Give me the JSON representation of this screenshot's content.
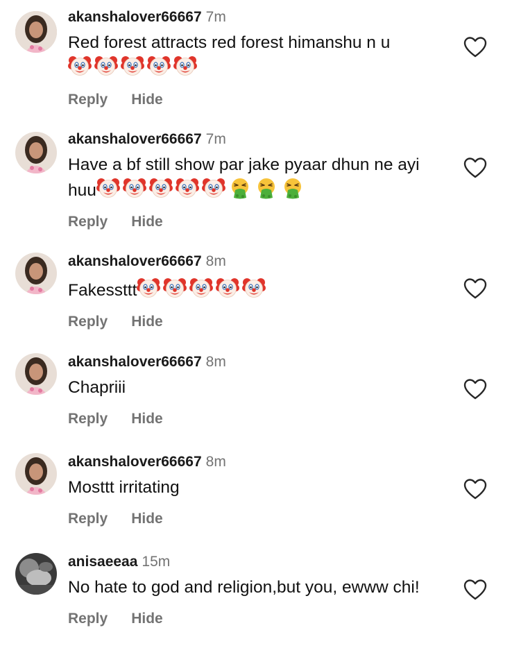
{
  "comments": [
    {
      "username": "akanshalover66667",
      "time": "7m",
      "text": "Red forest attracts red forest himanshu n u",
      "emojis": [
        "clown",
        "clown",
        "clown",
        "clown",
        "clown"
      ],
      "reply_label": "Reply",
      "hide_label": "Hide",
      "avatar": "woman-portrait"
    },
    {
      "username": "akanshalover66667",
      "time": "7m",
      "text": "Have a bf still show par jake pyaar dhun ne ayi huu",
      "emojis": [
        "clown",
        "clown",
        "clown",
        "clown",
        "clown",
        "vomit",
        "vomit",
        "vomit"
      ],
      "reply_label": "Reply",
      "hide_label": "Hide",
      "avatar": "woman-portrait"
    },
    {
      "username": "akanshalover66667",
      "time": "8m",
      "text": "Fakessttt",
      "emojis": [
        "clown",
        "clown",
        "clown",
        "clown",
        "clown"
      ],
      "reply_label": "Reply",
      "hide_label": "Hide",
      "avatar": "woman-portrait"
    },
    {
      "username": "akanshalover66667",
      "time": "8m",
      "text": "Chapriii",
      "emojis": [],
      "reply_label": "Reply",
      "hide_label": "Hide",
      "avatar": "woman-portrait"
    },
    {
      "username": "akanshalover66667",
      "time": "8m",
      "text": "Mosttt irritating",
      "emojis": [],
      "reply_label": "Reply",
      "hide_label": "Hide",
      "avatar": "woman-portrait"
    },
    {
      "username": "anisaeeaa",
      "time": "15m",
      "text": "No hate to god and religion,but you, ewww chi!",
      "emojis": [],
      "reply_label": "Reply",
      "hide_label": "Hide",
      "avatar": "grayscale-photo"
    }
  ],
  "icons": {
    "like": "heart-outline-icon"
  },
  "colors": {
    "text": "#111111",
    "secondary": "#737373",
    "background": "#ffffff"
  }
}
